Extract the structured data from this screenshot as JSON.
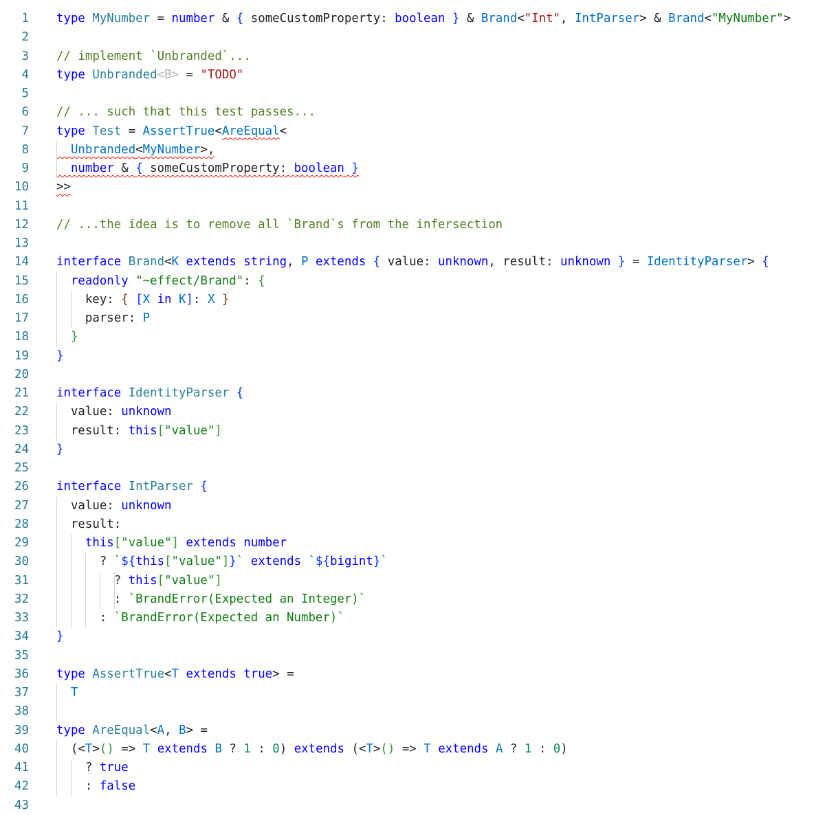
{
  "editor": {
    "language": "typescript",
    "error_color": "#e51400",
    "line_number_color": "#237893",
    "lines": [
      {
        "n": "1",
        "tokens": [
          [
            "kw",
            "type "
          ],
          [
            "ty",
            "MyNumber"
          ],
          [
            "p",
            " = "
          ],
          [
            "kw",
            "number"
          ],
          [
            "p",
            " & "
          ],
          [
            "br",
            "{ "
          ],
          [
            "p",
            "someCustomProperty: "
          ],
          [
            "kw",
            "boolean"
          ],
          [
            "br",
            " }"
          ],
          [
            "p",
            " & "
          ],
          [
            "ty2",
            "Brand"
          ],
          [
            "p",
            "<"
          ],
          [
            "str",
            "\"Int\""
          ],
          [
            "p",
            ", "
          ],
          [
            "ty2",
            "IntParser"
          ],
          [
            "p",
            "> & "
          ],
          [
            "ty2",
            "Brand"
          ],
          [
            "p",
            "<"
          ],
          [
            "str2",
            "\"MyNumber\""
          ],
          [
            "p",
            ">"
          ]
        ]
      },
      {
        "n": "2",
        "tokens": []
      },
      {
        "n": "3",
        "tokens": [
          [
            "cm",
            "// implement `Unbranded`..."
          ]
        ]
      },
      {
        "n": "4",
        "tokens": [
          [
            "kw",
            "type "
          ],
          [
            "ty",
            "Unbranded"
          ],
          [
            "tp",
            "<B>"
          ],
          [
            "p",
            " = "
          ],
          [
            "str",
            "\"TODO\""
          ]
        ]
      },
      {
        "n": "5",
        "tokens": []
      },
      {
        "n": "6",
        "tokens": [
          [
            "cm",
            "// ... such that this test passes..."
          ]
        ]
      },
      {
        "n": "7",
        "tokens": [
          [
            "kw",
            "type "
          ],
          [
            "ty",
            "Test"
          ],
          [
            "p",
            " = "
          ],
          [
            "ty2",
            "AssertTrue"
          ],
          [
            "p",
            "<"
          ],
          [
            "ty2 squig",
            "AreEqual"
          ],
          [
            "p",
            "<"
          ]
        ]
      },
      {
        "n": "8",
        "tokens": [
          [
            "p squig",
            "  "
          ],
          [
            "ty2 squig",
            "Unbranded"
          ],
          [
            "p squig",
            "<"
          ],
          [
            "ty2 squig",
            "MyNumber"
          ],
          [
            "p squig",
            ">,"
          ]
        ]
      },
      {
        "n": "9",
        "tokens": [
          [
            "p squig",
            "  "
          ],
          [
            "kw squig",
            "number"
          ],
          [
            "p squig",
            " & "
          ],
          [
            "br squig",
            "{ "
          ],
          [
            "p squig",
            "someCustomProperty: "
          ],
          [
            "kw squig",
            "boolean"
          ],
          [
            "br squig",
            " }"
          ]
        ]
      },
      {
        "n": "10",
        "tokens": [
          [
            "p squig",
            ">>"
          ]
        ]
      },
      {
        "n": "11",
        "tokens": []
      },
      {
        "n": "12",
        "tokens": [
          [
            "cm",
            "// ...the idea is to remove all `Brand`s from the infersection"
          ]
        ]
      },
      {
        "n": "13",
        "tokens": []
      },
      {
        "n": "14",
        "tokens": [
          [
            "kw",
            "interface "
          ],
          [
            "ty",
            "Brand"
          ],
          [
            "p",
            "<"
          ],
          [
            "ty2",
            "K"
          ],
          [
            "kw",
            " extends "
          ],
          [
            "kw",
            "string"
          ],
          [
            "p",
            ", "
          ],
          [
            "ty2",
            "P"
          ],
          [
            "kw",
            " extends "
          ],
          [
            "br",
            "{ "
          ],
          [
            "p",
            "value: "
          ],
          [
            "kw",
            "unknown"
          ],
          [
            "p",
            ", result: "
          ],
          [
            "kw",
            "unknown"
          ],
          [
            "br",
            " }"
          ],
          [
            "p",
            " = "
          ],
          [
            "ty2",
            "IdentityParser"
          ],
          [
            "p",
            "> "
          ],
          [
            "br",
            "{"
          ]
        ]
      },
      {
        "n": "15",
        "tokens": [
          [
            "p",
            "  "
          ],
          [
            "kw",
            "readonly "
          ],
          [
            "str2",
            "\"~effect/Brand\""
          ],
          [
            "p",
            ": "
          ],
          [
            "br2",
            "{"
          ]
        ]
      },
      {
        "n": "16",
        "tokens": [
          [
            "p",
            "    key: "
          ],
          [
            "br3",
            "{ "
          ],
          [
            "br",
            "["
          ],
          [
            "ty2",
            "X"
          ],
          [
            "kw",
            " in "
          ],
          [
            "ty2",
            "K"
          ],
          [
            "br",
            "]"
          ],
          [
            "p",
            ": "
          ],
          [
            "ty2",
            "X"
          ],
          [
            "br3",
            " }"
          ]
        ]
      },
      {
        "n": "17",
        "tokens": [
          [
            "p",
            "    parser: "
          ],
          [
            "ty2",
            "P"
          ]
        ]
      },
      {
        "n": "18",
        "tokens": [
          [
            "br2",
            "  }"
          ]
        ]
      },
      {
        "n": "19",
        "tokens": [
          [
            "br",
            "}"
          ]
        ]
      },
      {
        "n": "20",
        "tokens": []
      },
      {
        "n": "21",
        "tokens": [
          [
            "kw",
            "interface "
          ],
          [
            "ty",
            "IdentityParser"
          ],
          [
            "br",
            " {"
          ]
        ]
      },
      {
        "n": "22",
        "tokens": [
          [
            "p",
            "  value: "
          ],
          [
            "kw",
            "unknown"
          ]
        ]
      },
      {
        "n": "23",
        "tokens": [
          [
            "p",
            "  result: "
          ],
          [
            "kw",
            "this"
          ],
          [
            "br2",
            "["
          ],
          [
            "str2",
            "\"value\""
          ],
          [
            "br2",
            "]"
          ]
        ]
      },
      {
        "n": "24",
        "tokens": [
          [
            "br",
            "}"
          ]
        ]
      },
      {
        "n": "25",
        "tokens": []
      },
      {
        "n": "26",
        "tokens": [
          [
            "kw",
            "interface "
          ],
          [
            "ty",
            "IntParser"
          ],
          [
            "br",
            " {"
          ]
        ]
      },
      {
        "n": "27",
        "tokens": [
          [
            "p",
            "  value: "
          ],
          [
            "kw",
            "unknown"
          ]
        ]
      },
      {
        "n": "28",
        "tokens": [
          [
            "p",
            "  result:"
          ]
        ]
      },
      {
        "n": "29",
        "tokens": [
          [
            "p",
            "    "
          ],
          [
            "kw",
            "this"
          ],
          [
            "br2",
            "["
          ],
          [
            "str2",
            "\"value\""
          ],
          [
            "br2",
            "]"
          ],
          [
            "kw",
            " extends "
          ],
          [
            "kw",
            "number"
          ]
        ]
      },
      {
        "n": "30",
        "tokens": [
          [
            "p",
            "      ? "
          ],
          [
            "str2",
            "`"
          ],
          [
            "br",
            "${"
          ],
          [
            "kw",
            "this"
          ],
          [
            "br2",
            "["
          ],
          [
            "str2",
            "\"value\""
          ],
          [
            "br2",
            "]"
          ],
          [
            "br",
            "}"
          ],
          [
            "str2",
            "`"
          ],
          [
            "kw",
            " extends "
          ],
          [
            "str2",
            "`"
          ],
          [
            "br",
            "${"
          ],
          [
            "kw",
            "bigint"
          ],
          [
            "br",
            "}"
          ],
          [
            "str2",
            "`"
          ]
        ]
      },
      {
        "n": "31",
        "tokens": [
          [
            "p",
            "        ? "
          ],
          [
            "kw",
            "this"
          ],
          [
            "br2",
            "["
          ],
          [
            "str2",
            "\"value\""
          ],
          [
            "br2",
            "]"
          ]
        ]
      },
      {
        "n": "32",
        "tokens": [
          [
            "p",
            "        : "
          ],
          [
            "str2",
            "`BrandError(Expected an Integer)`"
          ]
        ]
      },
      {
        "n": "33",
        "tokens": [
          [
            "p",
            "      : "
          ],
          [
            "str2",
            "`BrandError(Expected an Number)`"
          ]
        ]
      },
      {
        "n": "34",
        "tokens": [
          [
            "br",
            "}"
          ]
        ]
      },
      {
        "n": "35",
        "tokens": []
      },
      {
        "n": "36",
        "tokens": [
          [
            "kw",
            "type "
          ],
          [
            "ty",
            "AssertTrue"
          ],
          [
            "p",
            "<"
          ],
          [
            "ty2",
            "T"
          ],
          [
            "kw",
            " extends "
          ],
          [
            "kw",
            "true"
          ],
          [
            "p",
            "> ="
          ]
        ]
      },
      {
        "n": "37",
        "tokens": [
          [
            "p",
            "  "
          ],
          [
            "ty2",
            "T"
          ]
        ]
      },
      {
        "n": "38",
        "tokens": []
      },
      {
        "n": "39",
        "tokens": [
          [
            "kw",
            "type "
          ],
          [
            "ty",
            "AreEqual"
          ],
          [
            "p",
            "<"
          ],
          [
            "ty2",
            "A"
          ],
          [
            "p",
            ", "
          ],
          [
            "ty2",
            "B"
          ],
          [
            "p",
            "> ="
          ]
        ]
      },
      {
        "n": "40",
        "tokens": [
          [
            "p",
            "  ("
          ],
          [
            "p",
            "<"
          ],
          [
            "ty2",
            "T"
          ],
          [
            "p",
            ">"
          ],
          [
            "br2",
            "()"
          ],
          [
            "p",
            " => "
          ],
          [
            "ty2",
            "T"
          ],
          [
            "kw",
            " extends "
          ],
          [
            "ty2",
            "B"
          ],
          [
            "p",
            " ? "
          ],
          [
            "num",
            "1"
          ],
          [
            "p",
            " : "
          ],
          [
            "num",
            "0"
          ],
          [
            "p",
            ")"
          ],
          [
            "kw",
            " extends "
          ],
          [
            "p",
            "("
          ],
          [
            "p",
            "<"
          ],
          [
            "ty2",
            "T"
          ],
          [
            "p",
            ">"
          ],
          [
            "br2",
            "()"
          ],
          [
            "p",
            " => "
          ],
          [
            "ty2",
            "T"
          ],
          [
            "kw",
            " extends "
          ],
          [
            "ty2",
            "A"
          ],
          [
            "p",
            " ? "
          ],
          [
            "num",
            "1"
          ],
          [
            "p",
            " : "
          ],
          [
            "num",
            "0"
          ],
          [
            "p",
            ")"
          ]
        ]
      },
      {
        "n": "41",
        "tokens": [
          [
            "p",
            "    ? "
          ],
          [
            "kw",
            "true"
          ]
        ]
      },
      {
        "n": "42",
        "tokens": [
          [
            "p",
            "    : "
          ],
          [
            "kw",
            "false"
          ]
        ]
      },
      {
        "n": "43",
        "tokens": []
      }
    ]
  }
}
